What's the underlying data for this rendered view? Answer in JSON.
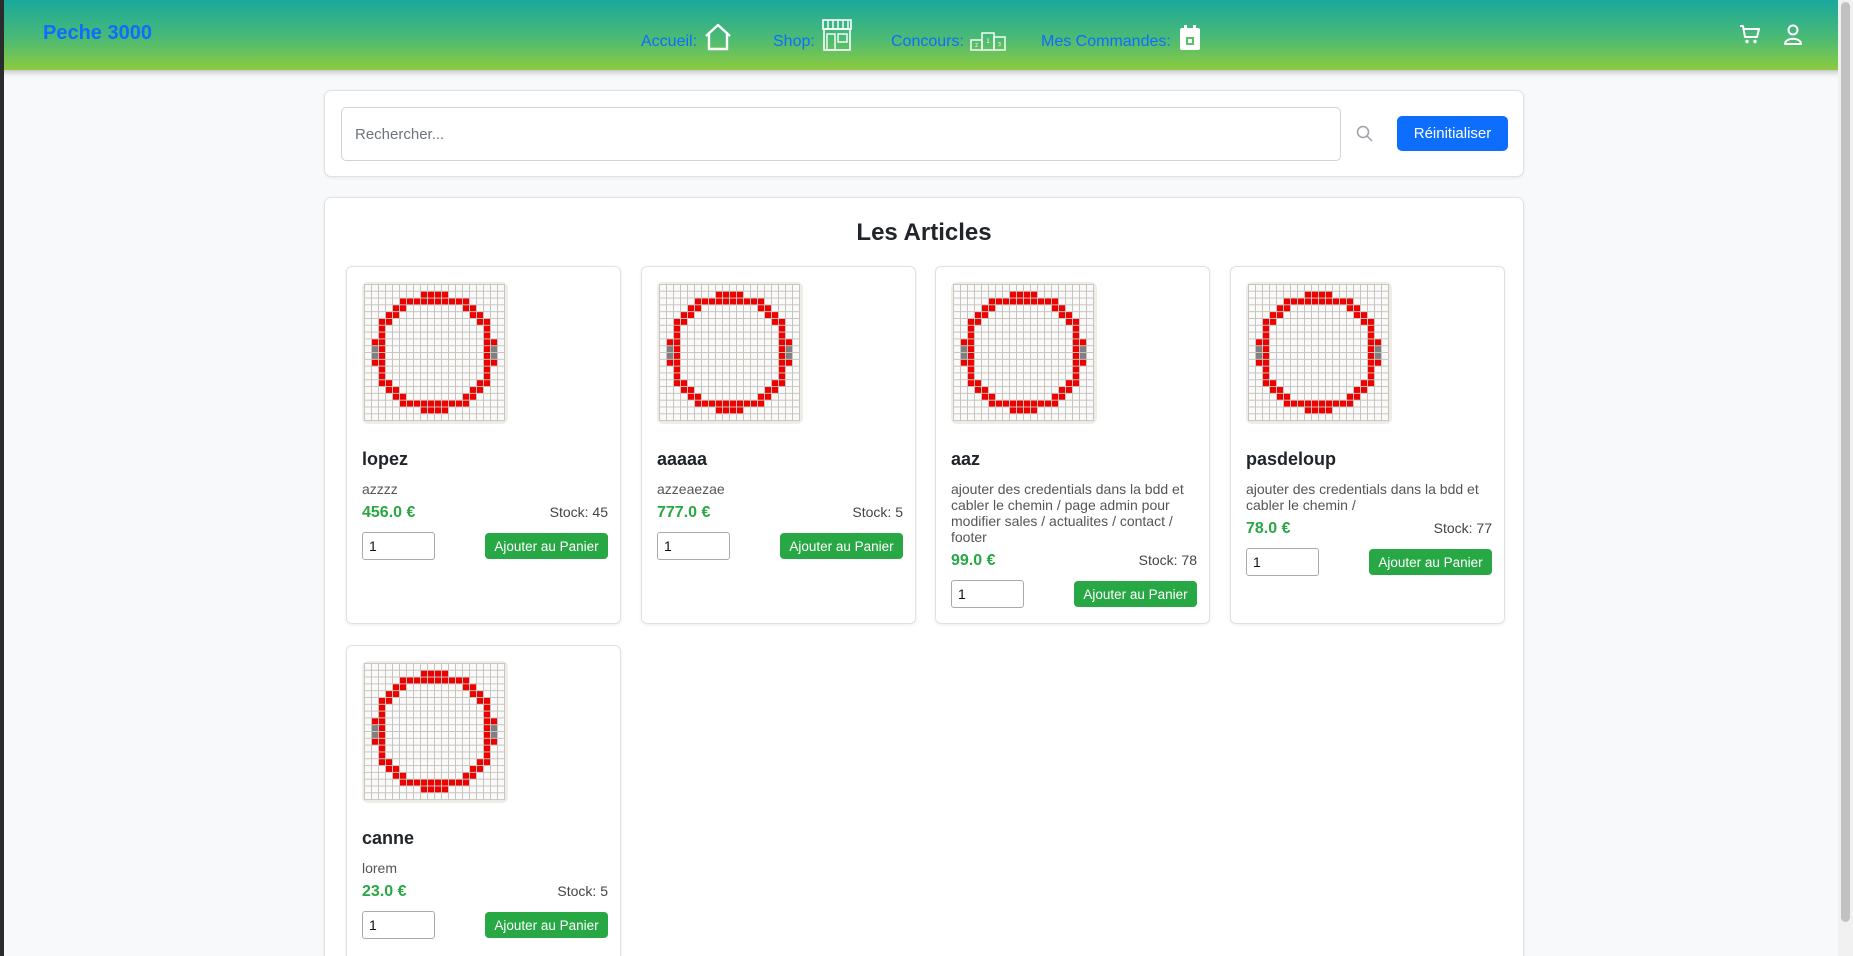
{
  "brand": "Peche 3000",
  "nav": [
    {
      "label": "Accueil:",
      "icon": "home-icon"
    },
    {
      "label": "Shop:",
      "icon": "shop-icon"
    },
    {
      "label": "Concours:",
      "icon": "podium-icon"
    },
    {
      "label": "Mes Commandes:",
      "icon": "calendar-icon"
    }
  ],
  "header_icons": [
    "cart-icon",
    "user-icon"
  ],
  "search": {
    "placeholder": "Rechercher...",
    "value": "",
    "reset_label": "Réinitialiser"
  },
  "section_title": "Les Articles",
  "add_label": "Ajouter au Panier",
  "products": [
    {
      "name": "lopez",
      "description": "azzzz",
      "price": "456.0 €",
      "stock": "Stock: 45",
      "qty": "1"
    },
    {
      "name": "aaaaa",
      "description": "azzeaezae",
      "price": "777.0 €",
      "stock": "Stock: 5",
      "qty": "1"
    },
    {
      "name": "aaz",
      "description": "ajouter des credentials dans la bdd et cabler le chemin / page admin pour modifier sales / actualites / contact / footer",
      "price": "99.0 €",
      "stock": "Stock: 78",
      "qty": "1"
    },
    {
      "name": "pasdeloup",
      "description": "ajouter des credentials dans la bdd et cabler le chemin /",
      "price": "78.0 €",
      "stock": "Stock: 77",
      "qty": "1"
    },
    {
      "name": "canne",
      "description": "lorem",
      "price": "23.0 €",
      "stock": "Stock: 5",
      "qty": "1"
    }
  ],
  "colors": {
    "brand": "#0d6efd",
    "price": "#28a745",
    "add_button": "#28a745",
    "reset_button": "#0d6efd",
    "ring": "#ee0000"
  }
}
